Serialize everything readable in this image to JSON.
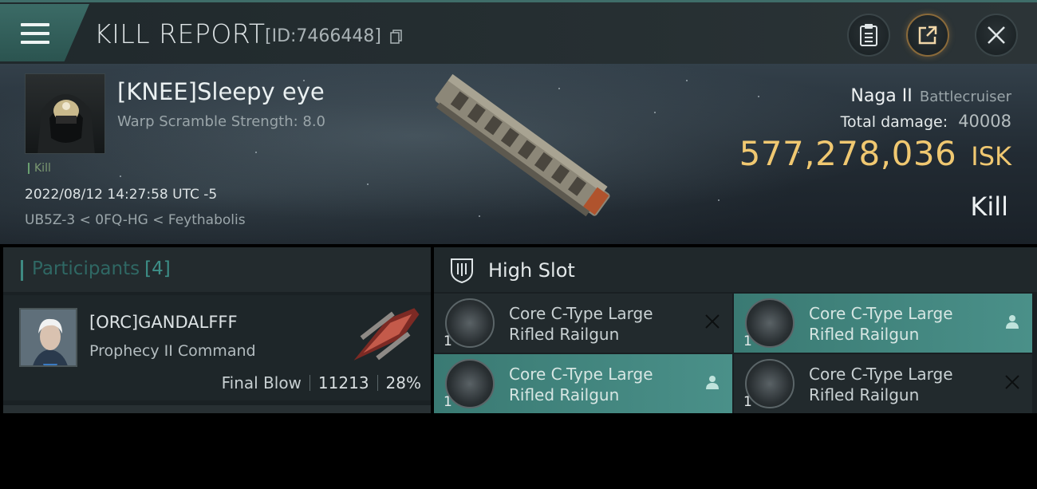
{
  "header": {
    "title": "KILL REPORT",
    "report_id": "[ID:7466448]",
    "icons": [
      "menu-icon",
      "copy-icon",
      "clipboard-icon",
      "share-icon",
      "close-icon"
    ]
  },
  "victim": {
    "name": "[KNEE]Sleepy eye",
    "warp_scramble": "Warp Scramble Strength: 8.0",
    "tag": "Kill",
    "datetime": "2022/08/12 14:27:58 UTC -5",
    "route": "UB5Z-3 < 0FQ-HG < Feythabolis"
  },
  "ship": {
    "name": "Naga II",
    "class": "Battlecruiser",
    "damage_label": "Total damage:",
    "damage_value": "40008",
    "isk_value": "577,278,036",
    "isk_unit": "ISK",
    "result": "Kill"
  },
  "participants": {
    "title": "Participants",
    "count": "[4]",
    "items": [
      {
        "name": "[ORC]GANDALFFF",
        "ship": "Prophecy II Command",
        "blow": "Final Blow",
        "damage": "11213",
        "percent": "28%"
      }
    ]
  },
  "high_slot": {
    "title": "High Slot",
    "modules": [
      {
        "name": "Core C-Type Large Rifled Railgun",
        "qty": "1",
        "status": "destroyed",
        "action_icon": "close-icon"
      },
      {
        "name": "Core C-Type Large Rifled Railgun",
        "qty": "1",
        "status": "dropped",
        "action_icon": "person-icon"
      },
      {
        "name": "Core C-Type Large Rifled Railgun",
        "qty": "1",
        "status": "dropped",
        "action_icon": "person-icon"
      },
      {
        "name": "Core C-Type Large Rifled Railgun",
        "qty": "1",
        "status": "destroyed",
        "action_icon": "close-icon"
      }
    ]
  },
  "colors": {
    "accent_teal": "#3e8a82",
    "isk_gold": "#f0c871",
    "dropped_bg": "#4a9089"
  }
}
